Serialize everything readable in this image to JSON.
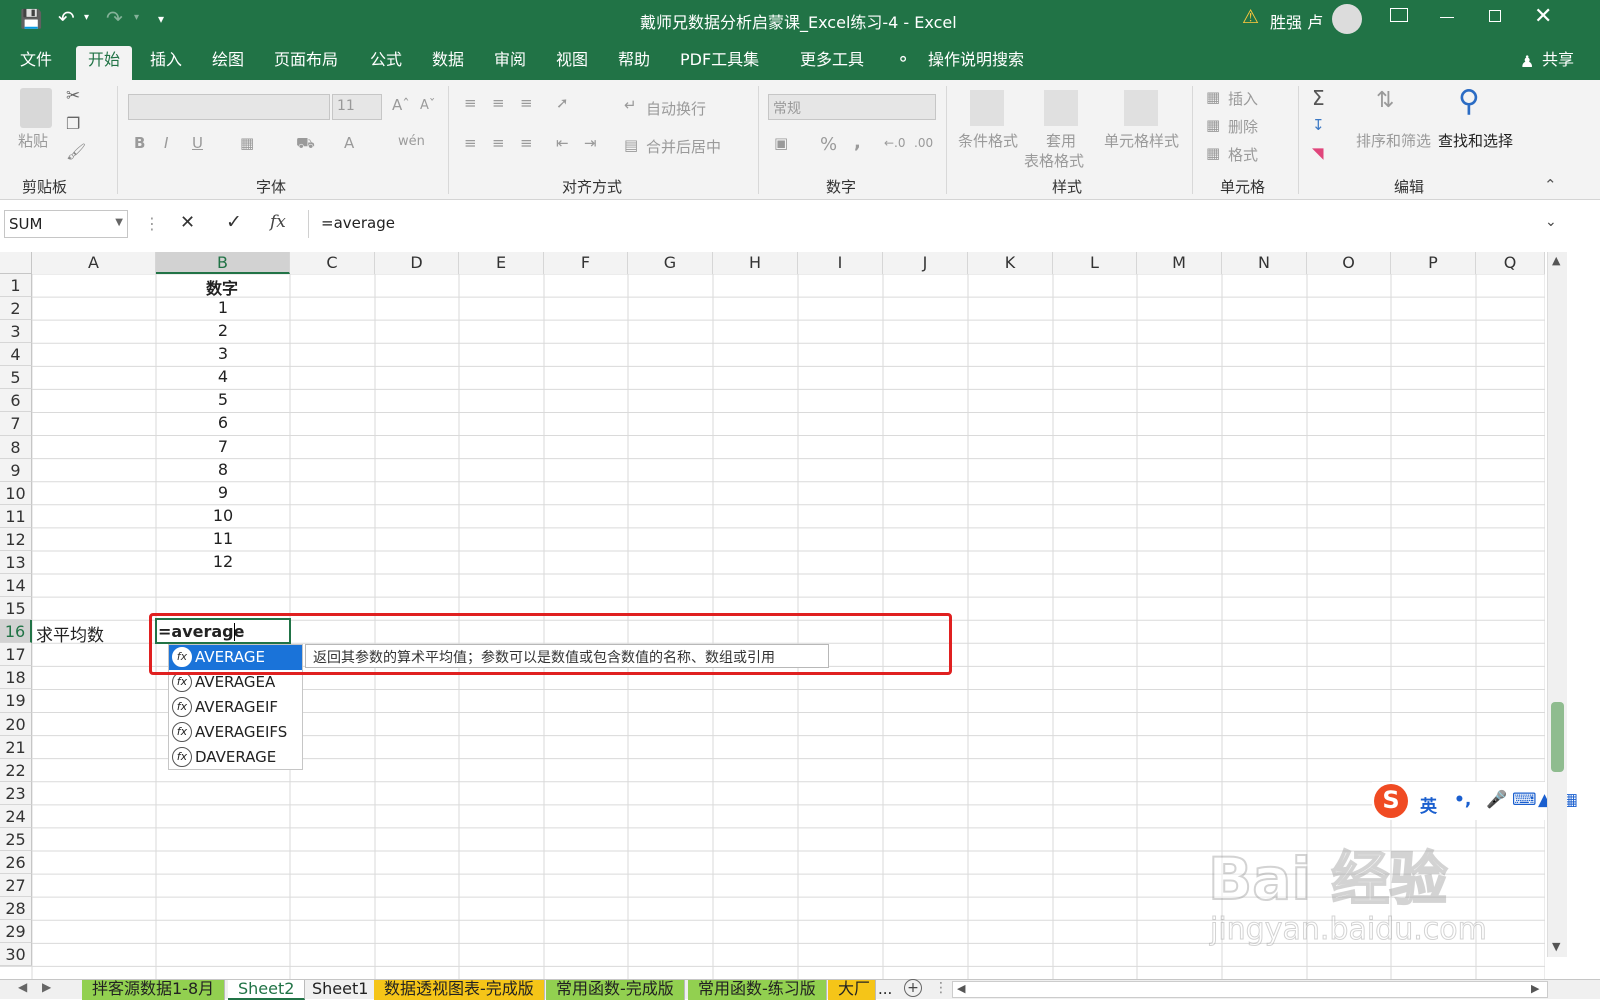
{
  "window": {
    "title": "戴师兄数据分析启蒙课_Excel练习-4  -  Excel",
    "user": "胜强 卢",
    "warning_icon": "warning-icon"
  },
  "tabs": [
    "文件",
    "开始",
    "插入",
    "绘图",
    "页面布局",
    "公式",
    "数据",
    "审阅",
    "视图",
    "帮助",
    "PDF工具集",
    "更多工具"
  ],
  "active_tab": "开始",
  "tell_me": "操作说明搜索",
  "share": "共享",
  "ribbon": {
    "clipboard": {
      "paste": "粘贴",
      "label": "剪贴板"
    },
    "font": {
      "size": "11",
      "bold": "B",
      "italic": "I",
      "underline": "U",
      "label": "字体"
    },
    "alignment": {
      "wrap": "自动换行",
      "merge": "合并后居中",
      "label": "对齐方式"
    },
    "number": {
      "format": "常规",
      "percent": "%",
      "comma": ",",
      "label": "数字"
    },
    "styles": {
      "conditional": "条件格式",
      "table1": "套用",
      "table2": "表格格式",
      "cell_styles": "单元格样式",
      "label": "样式"
    },
    "cells": {
      "insert": "插入",
      "delete": "删除",
      "format": "格式",
      "label": "单元格"
    },
    "editing": {
      "sort": "排序和筛选",
      "find": "查找和选择",
      "label": "编辑"
    }
  },
  "formula_bar": {
    "name_box": "SUM",
    "formula": "=average",
    "fx": "fx"
  },
  "columns": [
    "A",
    "B",
    "C",
    "D",
    "E",
    "F",
    "G",
    "H",
    "I",
    "J",
    "K",
    "L",
    "M",
    "N",
    "O",
    "P",
    "Q"
  ],
  "rows": [
    "1",
    "2",
    "3",
    "4",
    "5",
    "6",
    "7",
    "8",
    "9",
    "10",
    "11",
    "12",
    "13",
    "14",
    "15",
    "16",
    "17",
    "18",
    "19",
    "20",
    "21",
    "22",
    "23",
    "24",
    "25",
    "26",
    "27",
    "28",
    "29",
    "30"
  ],
  "cells": {
    "B1": "数字",
    "B_values": [
      "1",
      "2",
      "3",
      "4",
      "5",
      "6",
      "7",
      "8",
      "9",
      "10",
      "11",
      "12"
    ],
    "A16": "求平均数",
    "B16": "=average"
  },
  "autocomplete": {
    "items": [
      "AVERAGE",
      "AVERAGEA",
      "AVERAGEIF",
      "AVERAGEIFS",
      "DAVERAGE"
    ],
    "selected": "AVERAGE",
    "tooltip": "返回其参数的算术平均值；参数可以是数值或包含数值的名称、数组或引用"
  },
  "ime": {
    "lang": "英",
    "punct": "•,"
  },
  "sheets": [
    "拌客源数据1-8月",
    "Sheet2",
    "Sheet1",
    "数据透视图表-完成版",
    "常用函数-完成版",
    "常用函数-练习版",
    "大厂"
  ],
  "active_sheet": "Sheet2",
  "sheet_overflow": "...",
  "watermark": {
    "brand": "Bai 经验",
    "url": "jingyan.baidu.com"
  },
  "colors": {
    "excel_green": "#217346",
    "highlight_red": "#e02020",
    "selection_blue": "#1a73d9",
    "tab_yellow": "#f5c518",
    "tab_green": "#92d050"
  }
}
